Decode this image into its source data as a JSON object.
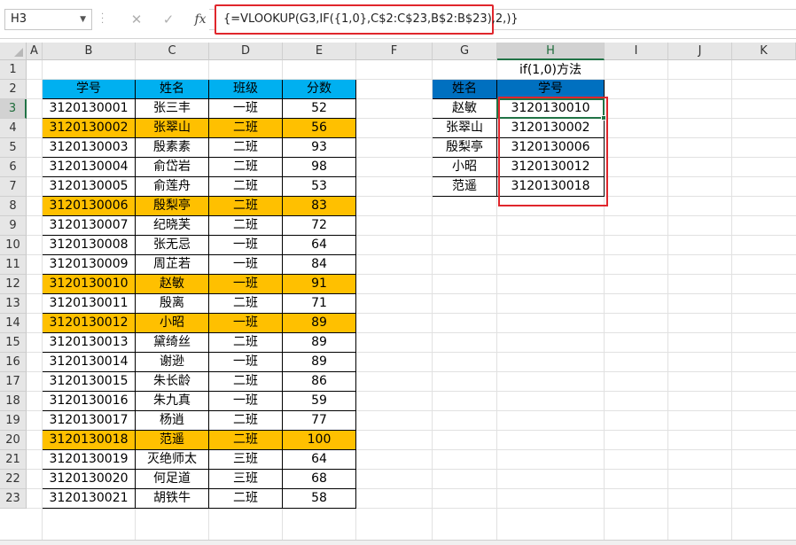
{
  "name_box": "H3",
  "formula_buttons": {
    "cancel": "✕",
    "enter": "✓",
    "fx": "fx"
  },
  "formula": "{=VLOOKUP(G3,IF({1,0},C$2:C$23,B$2:B$23),2,)}",
  "columns": [
    "A",
    "B",
    "C",
    "D",
    "E",
    "F",
    "G",
    "H",
    "I",
    "J",
    "K"
  ],
  "rows": [
    "1",
    "2",
    "3",
    "4",
    "5",
    "6",
    "7",
    "8",
    "9",
    "10",
    "11",
    "12",
    "13",
    "14",
    "15",
    "16",
    "17",
    "18",
    "19",
    "20",
    "21",
    "22",
    "23"
  ],
  "title_h1": "if(1,0)方法",
  "main_table": {
    "headers": [
      "学号",
      "姓名",
      "班级",
      "分数"
    ],
    "rows": [
      [
        "3120130001",
        "张三丰",
        "一班",
        "52"
      ],
      [
        "3120130002",
        "张翠山",
        "二班",
        "56"
      ],
      [
        "3120130003",
        "殷素素",
        "二班",
        "93"
      ],
      [
        "3120130004",
        "俞岱岩",
        "二班",
        "98"
      ],
      [
        "3120130005",
        "俞莲舟",
        "二班",
        "53"
      ],
      [
        "3120130006",
        "殷梨亭",
        "二班",
        "83"
      ],
      [
        "3120130007",
        "纪晓芙",
        "二班",
        "72"
      ],
      [
        "3120130008",
        "张无忌",
        "一班",
        "64"
      ],
      [
        "3120130009",
        "周芷若",
        "一班",
        "84"
      ],
      [
        "3120130010",
        "赵敏",
        "一班",
        "91"
      ],
      [
        "3120130011",
        "殷离",
        "二班",
        "71"
      ],
      [
        "3120130012",
        "小昭",
        "一班",
        "89"
      ],
      [
        "3120130013",
        "黛绮丝",
        "二班",
        "89"
      ],
      [
        "3120130014",
        "谢逊",
        "一班",
        "89"
      ],
      [
        "3120130015",
        "朱长龄",
        "二班",
        "86"
      ],
      [
        "3120130016",
        "朱九真",
        "一班",
        "59"
      ],
      [
        "3120130017",
        "杨逍",
        "二班",
        "77"
      ],
      [
        "3120130018",
        "范遥",
        "二班",
        "100"
      ],
      [
        "3120130019",
        "灭绝师太",
        "三班",
        "64"
      ],
      [
        "3120130020",
        "何足道",
        "三班",
        "68"
      ],
      [
        "3120130021",
        "胡铁牛",
        "二班",
        "58"
      ]
    ],
    "highlighted_rows": [
      1,
      5,
      9,
      11,
      17
    ]
  },
  "lookup_table": {
    "headers": [
      "姓名",
      "学号"
    ],
    "rows": [
      [
        "赵敏",
        "3120130010"
      ],
      [
        "张翠山",
        "3120130002"
      ],
      [
        "殷梨亭",
        "3120130006"
      ],
      [
        "小昭",
        "3120130012"
      ],
      [
        "范遥",
        "3120130018"
      ]
    ]
  },
  "colors": {
    "header_main": "#00b0f0",
    "header_lookup": "#0070c0",
    "highlight": "#ffc000",
    "annotation": "#e0262c",
    "selection": "#217346"
  }
}
